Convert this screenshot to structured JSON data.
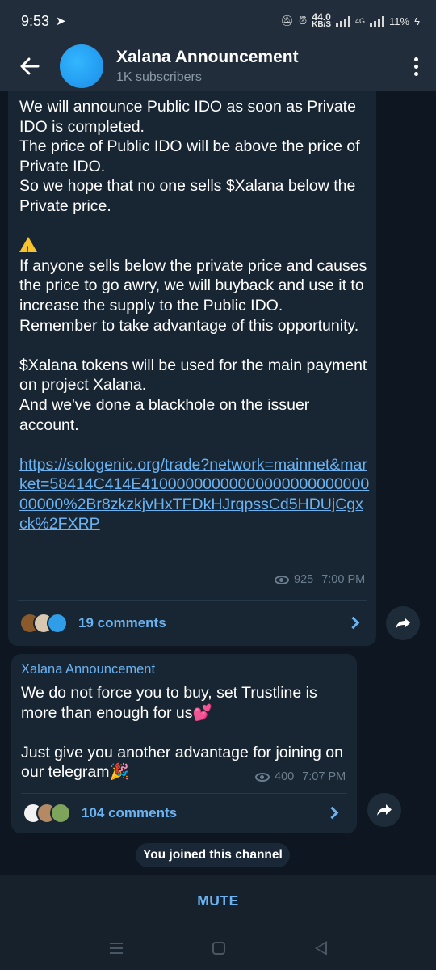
{
  "status_bar": {
    "time": "9:53",
    "speed_value": "44.0",
    "speed_unit": "KB/S",
    "network": "4G",
    "battery": "11%"
  },
  "header": {
    "title": "Xalana Announcement",
    "subtitle": "1K subscribers"
  },
  "messages": [
    {
      "text_part1": "We will announce Public IDO as soon as Private IDO is completed.\nThe price of Public IDO will be above the price of Private IDO.\nSo we hope that no one sells $Xalana below the Private price.\n\n",
      "text_part2": "\nIf anyone sells below the private price and causes the price to go awry, we will buyback and use it to increase the supply to the Public IDO.\nRemember to take advantage of this opportunity.\n\n$Xalana tokens will be used for the main payment on project Xalana.\nAnd we've done a blackhole on the issuer account.\n\n",
      "link": "https://sologenic.org/trade?network=mainnet&market=58414C414E4100000000000000000000000000000%2Br8zkzkjvHxTFDkHJrqpssCd5HDUjCgxck%2FXRP",
      "views": "925",
      "time": "7:00 PM",
      "comments": "19 comments"
    },
    {
      "sender": "Xalana Announcement",
      "text_part1": "We do not force you to buy, set Trustline is more than enough for us💕\n\nJust give you another advantage for joining on our telegram🎉",
      "views": "400",
      "time": "7:07 PM",
      "comments": "104 comments"
    }
  ],
  "service_message": "You joined this channel",
  "bottom": {
    "mute_label": "MUTE"
  },
  "colors": {
    "accent": "#6ab3f3",
    "bubble": "#182533",
    "background": "#0e1621",
    "header": "#212d3b"
  }
}
